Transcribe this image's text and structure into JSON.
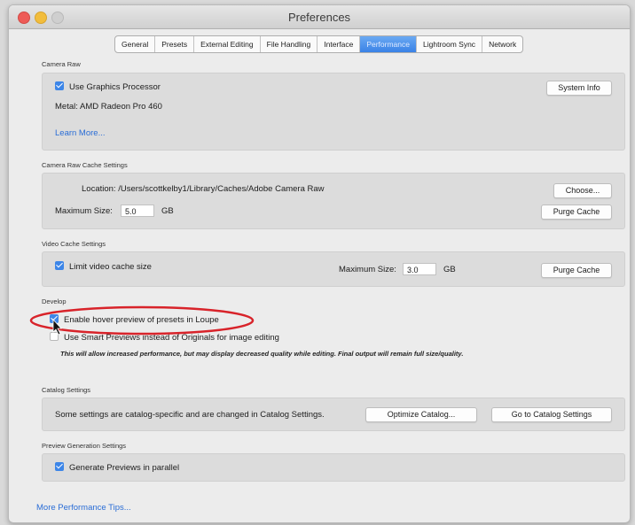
{
  "window": {
    "title": "Preferences"
  },
  "tabs": [
    "General",
    "Presets",
    "External Editing",
    "File Handling",
    "Interface",
    "Performance",
    "Lightroom Sync",
    "Network"
  ],
  "active_tab": "Performance",
  "camera_raw": {
    "section_label": "Camera Raw",
    "use_gpu_label": "Use Graphics Processor",
    "use_gpu_checked": true,
    "system_info_button": "System Info",
    "metal_text": "Metal: AMD Radeon Pro 460",
    "learn_more_link": "Learn More..."
  },
  "cache": {
    "section_label": "Camera Raw Cache Settings",
    "location_label": "Location:",
    "location_value": "/Users/scottkelby1/Library/Caches/Adobe Camera Raw",
    "choose_button": "Choose...",
    "max_size_label": "Maximum Size:",
    "max_size_value": "5.0",
    "unit": "GB",
    "purge_button": "Purge Cache"
  },
  "video_cache": {
    "section_label": "Video Cache Settings",
    "limit_label": "Limit video cache size",
    "limit_checked": true,
    "max_size_label": "Maximum Size:",
    "max_size_value": "3.0",
    "unit": "GB",
    "purge_button": "Purge Cache"
  },
  "develop": {
    "section_label": "Develop",
    "hover_label": "Enable hover preview of presets in Loupe",
    "hover_checked": true,
    "smart_label": "Use Smart Previews instead of Originals for image editing",
    "smart_checked": false,
    "note": "This will allow increased performance, but may display decreased quality while editing. Final output will remain full size/quality."
  },
  "catalog": {
    "section_label": "Catalog Settings",
    "text": "Some settings are catalog-specific and are changed in Catalog Settings.",
    "optimize_button": "Optimize Catalog...",
    "goto_button": "Go to Catalog Settings"
  },
  "preview": {
    "section_label": "Preview Generation Settings",
    "parallel_label": "Generate Previews in parallel",
    "parallel_checked": true
  },
  "footer": {
    "tips_link": "More Performance Tips..."
  },
  "colors": {
    "accent": "#3d86e8",
    "highlight_circle": "#d8232a",
    "link": "#2a6dd6"
  }
}
